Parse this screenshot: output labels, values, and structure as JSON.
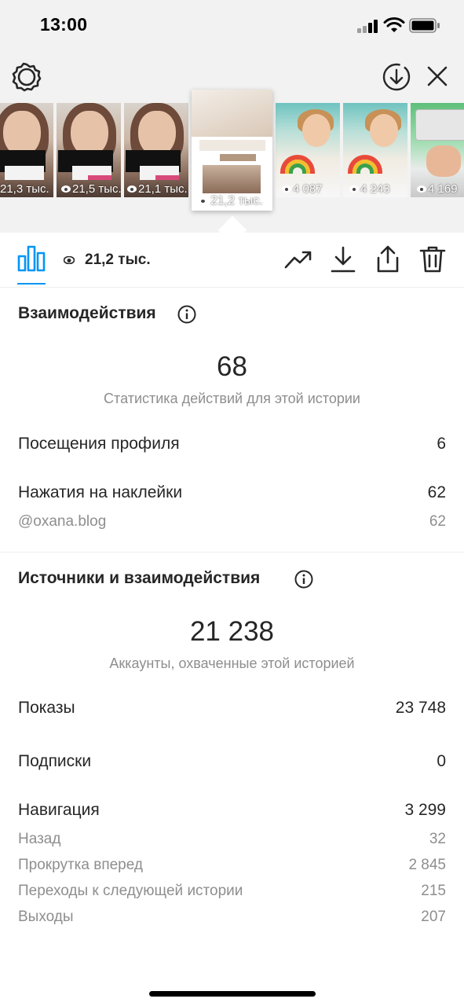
{
  "status_bar": {
    "time": "13:00"
  },
  "stories": [
    {
      "views": "21,3 тыс.",
      "kind": "face"
    },
    {
      "views": "21,5 тыс.",
      "kind": "face"
    },
    {
      "views": "21,1 тыс.",
      "kind": "face"
    },
    {
      "views": "21,2 тыс.",
      "kind": "selected"
    },
    {
      "views": "4 087",
      "kind": "kid"
    },
    {
      "views": "4 243",
      "kind": "kid"
    },
    {
      "views": "4 169",
      "kind": "green"
    }
  ],
  "toolbar": {
    "views": "21,2 тыс."
  },
  "interactions": {
    "title": "Взаимодействия",
    "total": "68",
    "caption": "Статистика действий для этой истории",
    "rows": [
      {
        "label": "Посещения профиля",
        "value": "6"
      },
      {
        "label": "Нажатия на наклейки",
        "value": "62"
      }
    ],
    "sub_rows": [
      {
        "label": "@oxana.blog",
        "value": "62"
      }
    ]
  },
  "discovery": {
    "title": "Источники и взаимодействия",
    "total": "21 238",
    "caption": "Аккаунты, охваченные этой историей",
    "rows": [
      {
        "label": "Показы",
        "value": "23 748"
      },
      {
        "label": "Подписки",
        "value": "0"
      },
      {
        "label": "Навигация",
        "value": "3 299"
      }
    ],
    "navigation": [
      {
        "label": "Назад",
        "value": "32"
      },
      {
        "label": "Прокрутка вперед",
        "value": "2 845"
      },
      {
        "label": "Переходы к следующей истории",
        "value": "215"
      },
      {
        "label": "Выходы",
        "value": "207"
      }
    ]
  },
  "colors": {
    "accent": "#0095f6",
    "text": "#262626",
    "muted": "#8e8e8e"
  }
}
